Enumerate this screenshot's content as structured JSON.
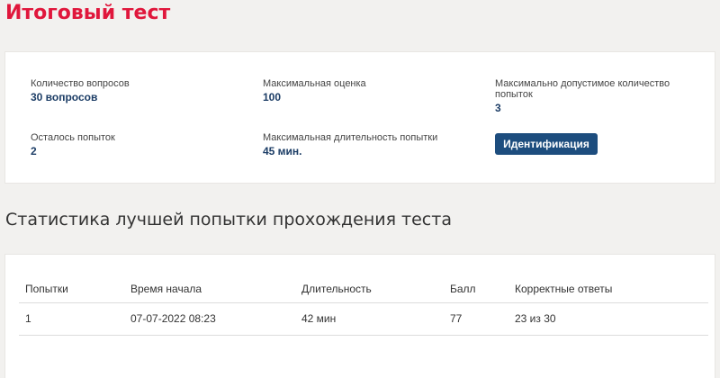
{
  "page": {
    "title": "Итоговый тест"
  },
  "info": {
    "question_count": {
      "label": "Количество вопросов",
      "value": "30 вопросов"
    },
    "max_score": {
      "label": "Максимальная оценка",
      "value": "100"
    },
    "max_attempts": {
      "label": "Максимально допустимое количество попыток",
      "value": "3"
    },
    "attempts_left": {
      "label": "Осталось попыток",
      "value": "2"
    },
    "max_duration": {
      "label": "Максимальная длительность попытки",
      "value": "45 мин."
    },
    "identify_button": "Идентификация"
  },
  "stats": {
    "heading": "Статистика лучшей попытки прохождения теста",
    "columns": [
      "Попытки",
      "Время начала",
      "Длительность",
      "Балл",
      "Корректные ответы"
    ],
    "rows": [
      [
        "1",
        "07-07-2022 08:23",
        "42 мин",
        "77",
        "23 из 30"
      ]
    ]
  },
  "colors": {
    "title": "#e0173c",
    "value_text": "#1c3d66",
    "button_bg": "#1d4d7e",
    "page_bg": "#f2f1ef"
  }
}
